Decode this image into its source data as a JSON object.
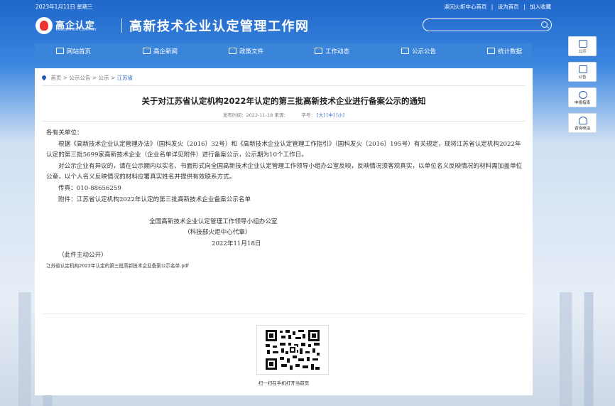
{
  "topbar": {
    "date": "2023年1月11日 星期三",
    "links": [
      "返回火炬中心首页",
      "|",
      "设为首页",
      "|",
      "加入收藏"
    ]
  },
  "header": {
    "logo_cn": "高企认定",
    "logo_en": "INNOVATION COMPANY",
    "site_title": "高新技术企业认定管理工作网"
  },
  "nav": {
    "items": [
      {
        "label": "网站首页",
        "icon": "home-icon"
      },
      {
        "label": "高企新闻",
        "icon": "news-icon"
      },
      {
        "label": "政策文件",
        "icon": "document-icon"
      },
      {
        "label": "工作动态",
        "icon": "send-icon"
      },
      {
        "label": "公示公告",
        "icon": "building-icon"
      },
      {
        "label": "统计数据",
        "icon": "chart-icon"
      }
    ]
  },
  "breadcrumb": {
    "items": [
      "首页",
      ">",
      "公示公告",
      ">",
      "公示",
      ">"
    ],
    "current": "江苏省"
  },
  "article": {
    "title": "关于对江苏省认定机构2022年认定的第三批高新技术企业进行备案公示的通知",
    "meta_date": "发布时间：2022-11-18 来源：",
    "meta_size": "字号：",
    "font_large": "[大]",
    "font_medium": "[中]",
    "font_small": "[小]",
    "greeting": "各有关单位：",
    "para1": "根据《高新技术企业认定管理办法》（国科发火〔2016〕32号）和《高新技术企业认定管理工作指引》（国科发火〔2016〕195号）有关规定，现将江苏省认定机构2022年认定的第三批5699家高新技术企业（企业名单详见附件）进行备案公示，公示期为10个工作日。",
    "para2": "对公示企业有异议的，请在公示期内以实名、书面形式向全国高新技术企业认定管理工作领导小组办公室反映，反映情况须客观真实，以单位名义反映情况的材料需加盖单位公章，以个人名义反映情况的材料应署真实姓名并提供有效联系方式。",
    "fax": "传真：010-88656259",
    "attachment_line": "附件：江苏省认定机构2022年认定的第三批高新技术企业备案公示名单",
    "sign_org": "全国高新技术企业认定管理工作领导小组办公室",
    "sign_proxy": "（科技部火炬中心代章）",
    "sign_date": "2022年11月18日",
    "public_note": "（此件主动公开）",
    "attachment_file": "江苏省认定机构2022年认定的第三批高新技术企业备案公示名单.pdf"
  },
  "qr": {
    "caption": "扫一扫在手机打开当前页"
  },
  "sidebar": {
    "items": [
      {
        "label": "公示",
        "icon": "notice-icon"
      },
      {
        "label": "公告",
        "icon": "announcement-icon"
      },
      {
        "label": "申报指南",
        "icon": "compass-icon"
      },
      {
        "label": "咨询电话",
        "icon": "phone-icon"
      }
    ]
  },
  "colors": {
    "header_bg": "#1f67c9",
    "nav_bg": "#3a85da",
    "link": "#2a68c8"
  }
}
